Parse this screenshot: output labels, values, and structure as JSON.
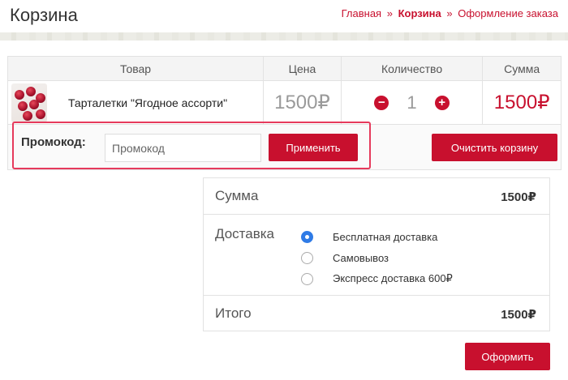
{
  "header": {
    "title": "Корзина",
    "breadcrumb": {
      "home": "Главная",
      "separator": "»",
      "cart": "Корзина",
      "checkout": "Оформление заказа"
    }
  },
  "cart": {
    "columns": {
      "product": "Товар",
      "price": "Цена",
      "quantity": "Количество",
      "sum": "Сумма"
    },
    "items": [
      {
        "name": "Тарталетки \"Ягодное ассорти\"",
        "price": "1500₽",
        "quantity": "1",
        "sum": "1500₽"
      }
    ],
    "qty_minus_icon": "minus-circle-icon",
    "qty_plus_icon": "plus-circle-icon",
    "promo": {
      "label": "Промокод:",
      "placeholder": "Промокод",
      "value": "",
      "apply_label": "Применить"
    },
    "clear_label": "Очистить корзину"
  },
  "summary": {
    "sum_label": "Сумма",
    "sum_value": "1500₽",
    "delivery_label": "Доставка",
    "delivery_options": [
      {
        "label": "Бесплатная доставка",
        "selected": true
      },
      {
        "label": "Самовывоз",
        "selected": false
      },
      {
        "label": "Экспресс доставка 600₽",
        "selected": false
      }
    ],
    "total_label": "Итого",
    "total_value": "1500₽"
  },
  "checkout_label": "Оформить",
  "colors": {
    "accent": "#c8102e",
    "radio_selected": "#2f7be6",
    "highlight": "#e63a5c"
  }
}
